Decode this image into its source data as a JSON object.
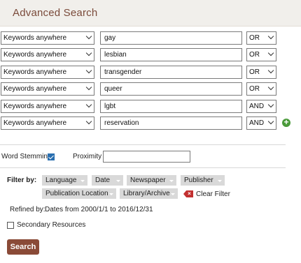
{
  "header": {
    "title": "Advanced Search"
  },
  "search_rows": [
    {
      "field": "Keywords anywhere",
      "term": "gay",
      "operator": "OR"
    },
    {
      "field": "Keywords anywhere",
      "term": "lesbian",
      "operator": "OR"
    },
    {
      "field": "Keywords anywhere",
      "term": "transgender",
      "operator": "OR"
    },
    {
      "field": "Keywords anywhere",
      "term": "queer",
      "operator": "OR"
    },
    {
      "field": "Keywords anywhere",
      "term": "lgbt",
      "operator": "AND"
    },
    {
      "field": "Keywords anywhere",
      "term": "reservation",
      "operator": "AND"
    }
  ],
  "add_row_icon": "plus-circle-icon",
  "options": {
    "word_stemming_label": "Word Stemming",
    "word_stemming_checked": true,
    "proximity_label": "Proximity",
    "proximity_value": ""
  },
  "filters": {
    "label": "Filter by:",
    "chips": [
      "Language",
      "Date",
      "Newspaper",
      "Publisher",
      "Publication Location",
      "Library/Archive"
    ],
    "clear_label": "Clear Filter"
  },
  "refined": {
    "label": "Refined by:",
    "value": "Dates from 2000/1/1 to 2016/12/31"
  },
  "secondary": {
    "label": "Secondary Resources",
    "checked": false
  },
  "search_button": {
    "label": "Search"
  },
  "colors": {
    "accent": "#8a4a37",
    "title": "#7a4a3a",
    "add": "#4a9a3a",
    "clear": "#c23030",
    "check": "#2a6fb0"
  }
}
